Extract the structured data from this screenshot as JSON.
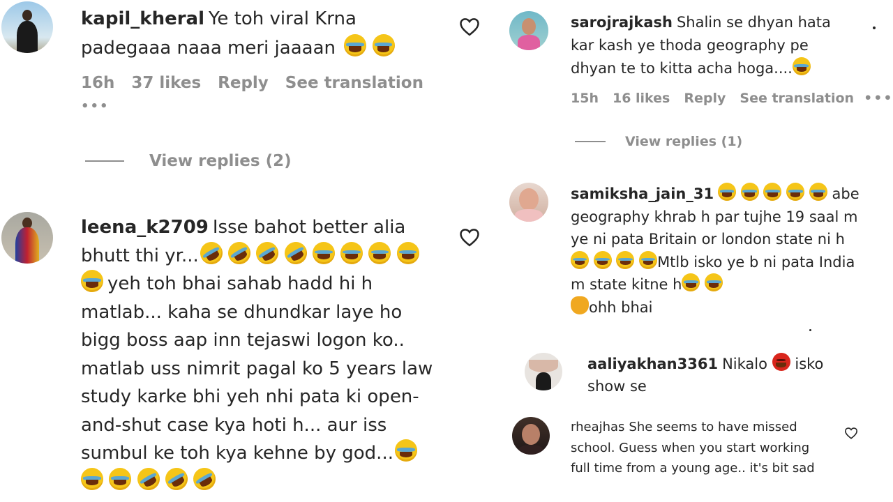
{
  "left": {
    "comments": [
      {
        "username": "kapil_kheral",
        "text": "Ye toh viral Krna padegaaa naaa meri jaaaan",
        "time": "16h",
        "likes": "37 likes",
        "reply": "Reply",
        "translation": "See translation",
        "more": "•••",
        "view_replies": "View replies (2)"
      },
      {
        "username": "leena_k2709",
        "text_a": "Isse bahot better alia bhutt thi yr...",
        "text_b": "yeh toh bhai sahab hadd hi h matlab... kaha se dhundkar laye ho bigg boss aap inn tejaswi logon ko.. matlab uss nimrit pagal ko 5 years law study karke bhi yeh nhi pata ki open-and-shut case kya hoti h... aur iss sumbul ke toh kya kehne by god..."
      }
    ]
  },
  "right": {
    "comments": [
      {
        "username": "sarojrajkash",
        "text": "Shalin se dhyan hata kar kash ye thoda geography pe dhyan te to kitta acha hoga....",
        "time": "15h",
        "likes": "16 likes",
        "reply": "Reply",
        "translation": "See translation",
        "more": "•••",
        "view_replies": "View replies (1)"
      },
      {
        "username": "samiksha_jain_31",
        "text_a": "abe geography khrab h par tujhe 19 saal m ye ni pata Britain or london state ni h",
        "text_b": "Mtlb isko ye b ni pata India m state kitne h",
        "text_c": "ohh bhai"
      },
      {
        "username": "aaliyakhan3361",
        "text_a": "Nikalo",
        "text_b": "isko show se"
      },
      {
        "username": "rheajhas",
        "text": "She seems to have missed school. Guess when you start working full time from a young age.. it's bit sad"
      }
    ]
  },
  "icons": {
    "heart": "heart-outline-icon",
    "joy": "face-with-tears-of-joy-icon",
    "rofl": "rolling-on-floor-laughing-icon",
    "angry": "angry-face-icon",
    "clap": "clapping-hands-icon"
  },
  "colors": {
    "text": "#262626",
    "meta": "#8e8e8e",
    "background": "#ffffff"
  }
}
